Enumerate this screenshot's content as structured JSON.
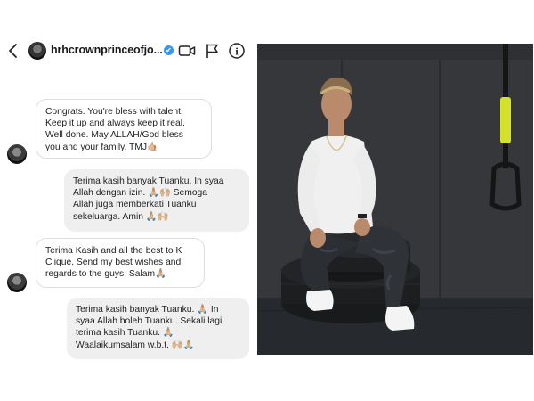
{
  "header": {
    "username": "hrhcrownprinceofjo...",
    "verified_mark": "✔",
    "back_icon": "chevron-left-icon",
    "avatar_icon": "avatar",
    "actions": [
      "video-call-icon",
      "flag-icon",
      "info-icon"
    ],
    "info_glyph": "i"
  },
  "messages": [
    {
      "direction": "incoming",
      "lines": [
        "Congrats. You're bless with talent.",
        "Keep it up and always keep it real.",
        "Well done. May ALLAH/God bless",
        "you and your family. TMJ🤙🏼"
      ]
    },
    {
      "direction": "outgoing",
      "lines": [
        "Terima kasih banyak Tuanku. In syaa",
        "Allah dengan izin. 🙏🏼🙌🏼 Semoga",
        "Allah juga memberkati Tuanku",
        "sekeluarga. Amin 🙏🏼🙌🏼"
      ]
    },
    {
      "direction": "incoming",
      "lines": [
        "Terima Kasih and all the best to K",
        "Clique. Send my best wishes and",
        "regards to the guys. Salam🙏🏼"
      ]
    },
    {
      "direction": "outgoing",
      "lines": [
        "Terima kasih banyak Tuanku. 🙏🏼  In",
        "syaa Allah boleh Tuanku. Sekali lagi",
        "terima kasih Tuanku. 🙏🏼",
        "Waalaikumsalam w.b.t. 🙌🏼🙏🏼"
      ]
    }
  ],
  "photo": {
    "description_icon": "portrait-photo",
    "colors": {
      "wall": "#34363a",
      "shirt": "#f2f2f2",
      "pants": "#2b2e33",
      "tires": "#1c1d1f",
      "strap_accent": "#d4e12a"
    }
  }
}
